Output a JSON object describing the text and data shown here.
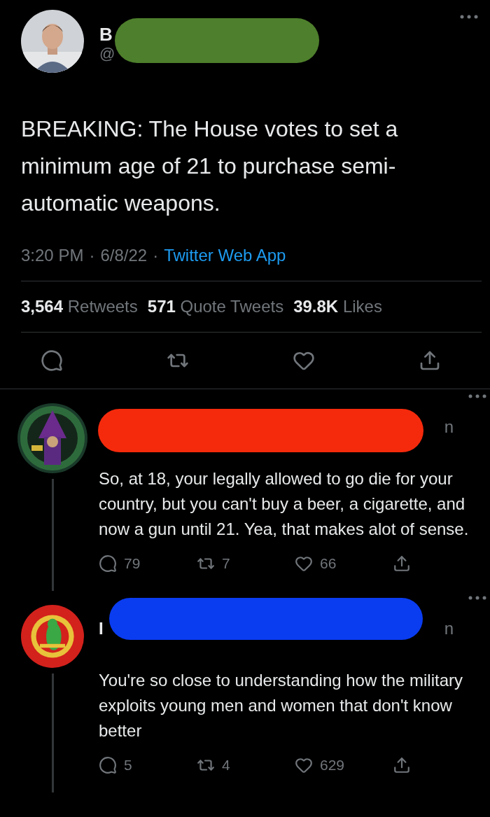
{
  "tweet": {
    "name_fragment": "B",
    "handle_fragment": "@",
    "redaction": {
      "color": "#4e7f2c"
    },
    "text": "BREAKING: The House votes to set a minimum age of 21 to purchase semi-automatic weapons.",
    "time": "3:20 PM",
    "separator_1": "·",
    "date": "6/8/22",
    "separator_2": "·",
    "source": "Twitter Web App",
    "stats": [
      {
        "count": "3,564",
        "label": "Retweets"
      },
      {
        "count": "571",
        "label": "Quote Tweets"
      },
      {
        "count": "39.8K",
        "label": "Likes"
      }
    ]
  },
  "replies": [
    {
      "redaction": {
        "color": "#f52a0c"
      },
      "time_fragment": "n",
      "text": "So, at 18, your legally allowed to go die for your country, but you can't buy a beer, a cigarette, and now a gun until 21. Yea, that makes alot of sense.",
      "reply_count": "79",
      "retweet_count": "7",
      "like_count": "66"
    },
    {
      "redaction": {
        "color": "#0a3cf0"
      },
      "name_fragment": "I",
      "time_fragment": "n",
      "text": "You're so close to understanding how the military exploits young men and women that don't know better",
      "reply_count": "5",
      "retweet_count": "4",
      "like_count": "629"
    }
  ]
}
